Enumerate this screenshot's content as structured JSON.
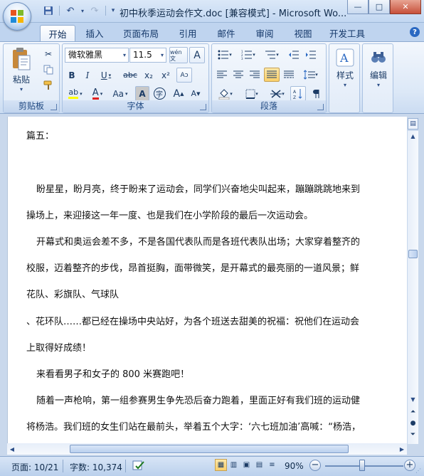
{
  "window": {
    "title": "初中秋季运动会作文.doc [兼容模式] - Microsoft Wo...",
    "min_label": "—",
    "max_label": "□",
    "close_label": "✕"
  },
  "qat": {
    "save": "💾",
    "undo": "↶",
    "redo": "↷",
    "more": "▾"
  },
  "tabs": [
    "开始",
    "插入",
    "页面布局",
    "引用",
    "邮件",
    "审阅",
    "视图",
    "开发工具"
  ],
  "active_tab": "开始",
  "help": "?",
  "ribbon": {
    "clipboard": {
      "label": "剪贴板",
      "paste": "粘贴"
    },
    "font": {
      "label": "字体",
      "name": "微软雅黑",
      "size": "11.5",
      "bold": "B",
      "italic": "I",
      "underline": "U",
      "strike": "abc",
      "subscript": "x₂",
      "superscript": "x²",
      "highlight": "ab",
      "color": "A",
      "case": "Aa",
      "shade": "A",
      "grow": "A",
      "shrink": "A",
      "phonetic": "wén 文",
      "border_char": "A",
      "enclose": "字"
    },
    "paragraph": {
      "label": "段落"
    },
    "styles": {
      "label": "样式"
    },
    "editing": {
      "label": "编辑"
    }
  },
  "document": {
    "lines": [
      "篇五：",
      "盼星星，盼月亮，终于盼来了运动会，同学们兴奋地尖叫起来，蹦蹦跳跳地来到",
      "操场上，来迎接这一年一度、也是我们在小学阶段的最后一次运动会。",
      "开幕式和奥运会差不多，不是各国代表队而是各班代表队出场；大家穿着整齐的",
      "校服，迈着整齐的步伐，昂首挺胸，面带微笑，是开幕式的最亮丽的一道风景；鲜",
      "花队、彩旗队、气球队",
      "、花环队……都已经在操场中央站好，为各个班送去甜美的祝福：祝他们在运动会",
      "上取得好成绩！",
      "来看看男子和女子的 800 米赛跑吧！",
      "随着一声枪响，第一组参赛男生争先恐后奋力跑着，里面正好有我们班的运动健",
      "将杨浩。我们班的女生们站在最前头，举着五个大字：‘六七班加油’高喊：“杨浩，"
    ]
  },
  "status": {
    "page": "页面: 10/21",
    "words": "字数: 10,374",
    "zoom": "90%",
    "zoom_minus": "−",
    "zoom_plus": "+"
  },
  "colors": {
    "highlight": "#ffff00",
    "font_color": "#e02020"
  }
}
